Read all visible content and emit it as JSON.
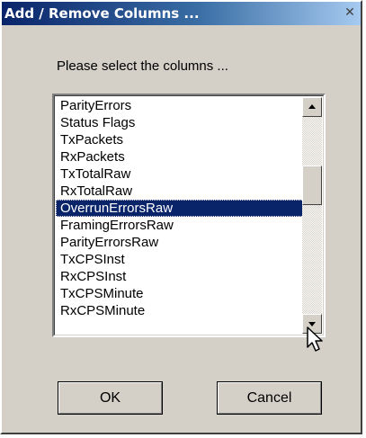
{
  "dialog": {
    "title": "Add / Remove Columns ...",
    "close_glyph": "✕",
    "prompt": "Please select the columns ...",
    "items": [
      "ParityErrors",
      "Status Flags",
      "TxPackets",
      "RxPackets",
      "TxTotalRaw",
      "RxTotalRaw",
      "OverrunErrorsRaw",
      "FramingErrorsRaw",
      "ParityErrorsRaw",
      "TxCPSInst",
      "RxCPSInst",
      "TxCPSMinute",
      "RxCPSMinute"
    ],
    "selected_item": "OverrunErrorsRaw",
    "ok_label": "OK",
    "cancel_label": "Cancel"
  },
  "colors": {
    "title_gradient_start": "#0a246a",
    "title_gradient_end": "#a6caf0",
    "dialog_face": "#d4d0c8",
    "selection": "#0a246a"
  },
  "icons": {
    "scroll_up": "up-arrow-icon",
    "scroll_down": "down-arrow-icon",
    "pointer": "mouse-pointer-icon"
  }
}
